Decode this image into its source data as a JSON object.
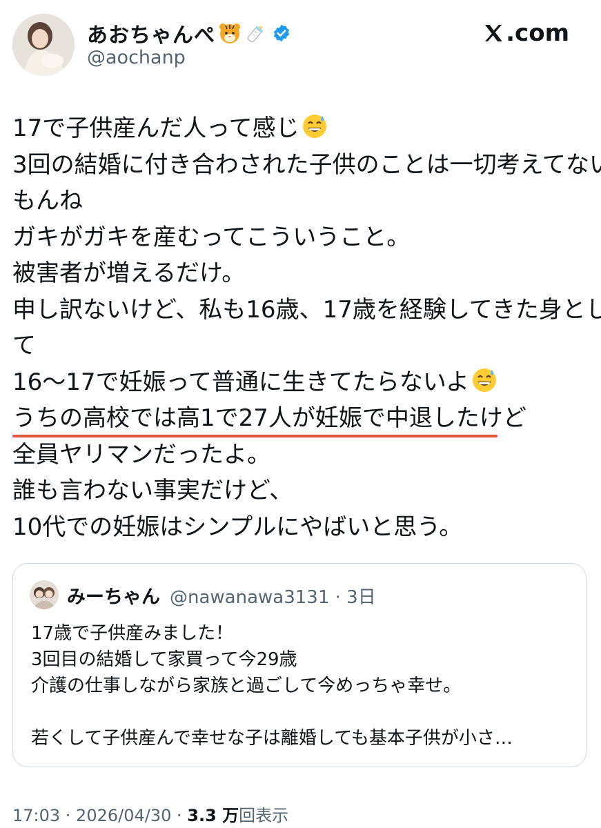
{
  "author": {
    "display_name": "あおちゃんぺ",
    "handle": "@aochanp",
    "name_emojis": [
      "tiger-face-emoji",
      "baby-bottle-emoji"
    ],
    "verified": true
  },
  "brand": {
    "label": ".com"
  },
  "tweet": {
    "lines": [
      "17で子供産んだ人って感じ",
      "3回の結婚に付き合わされた子供のことは一切考えてない",
      "もんね",
      "ガキがガキを産むってこういうこと。",
      "被害者が増えるだけ。",
      "申し訳ないけど、私も16歳、17歳を経験してきた身とし",
      "て",
      "16〜17で妊娠って普通に生きてたらないよ",
      "うちの高校では高1で27人が妊娠で中退したけど",
      "全員ヤリマンだったよ。",
      "誰も言わない事実だけど、",
      "10代での妊娠はシンプルにやばいと思う。"
    ],
    "underline_color": "#e8553a"
  },
  "quote": {
    "display_name": "みーちゃん",
    "handle_time": "@nawanawa3131 · 3日",
    "lines": [
      "17歳で子供産みました！",
      "3回目の結婚して家買って今29歳",
      "介護の仕事しながら家族と過ごして今めっちゃ幸せ。",
      "",
      "若くして子供産んで幸せな子は離婚しても基本子供が小さ…"
    ]
  },
  "meta": {
    "time_date": "17:03 · 2026/04/30 · ",
    "views_count": "3.3 万",
    "views_label": "回表示"
  },
  "colors": {
    "text": "#0f1419",
    "secondary": "#536471",
    "verified": "#1d9bf0",
    "border": "#cfd9de"
  }
}
